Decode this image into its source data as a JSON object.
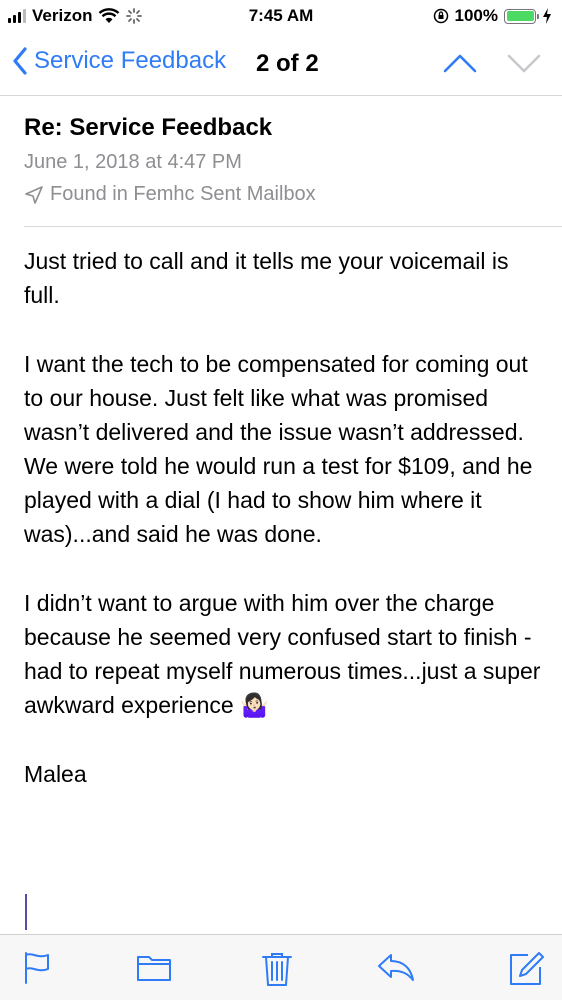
{
  "status_bar": {
    "carrier": "Verizon",
    "time": "7:45 AM",
    "battery_text": "100%",
    "battery_level": 1.0
  },
  "nav": {
    "back_label": "Service Feedback",
    "counter": "2 of 2"
  },
  "email": {
    "subject": "Re: Service Feedback",
    "date": "June 1, 2018 at 4:47 PM",
    "mailbox": "Found in Femhc Sent Mailbox",
    "paragraphs": [
      "Just tried to call and it tells me your voicemail is full.",
      "I want the tech to be compensated for coming out to our house. Just felt like what was promised wasn’t delivered and the issue wasn’t addressed. We were told he would run a test for $109, and he played with a dial (I had to show him where it was)...and said he was done.",
      "I didn’t want to argue with him over the charge because he seemed very confused start to finish - had to repeat myself numerous times...just a super awkward experience 🤷🏻‍♀️",
      "Malea"
    ]
  },
  "colors": {
    "accent": "#2f7cf6",
    "secondary_text": "#8e8e93",
    "battery_green": "#4cd964"
  },
  "toolbar": {
    "icons": [
      "flag-icon",
      "folder-icon",
      "trash-icon",
      "reply-icon",
      "compose-icon"
    ]
  }
}
